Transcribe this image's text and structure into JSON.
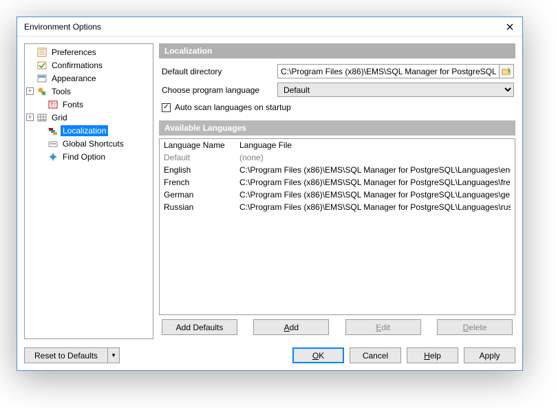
{
  "window_title": "Environment Options",
  "tree": {
    "preferences": "Preferences",
    "confirmations": "Confirmations",
    "appearance": "Appearance",
    "tools": "Tools",
    "fonts": "Fonts",
    "grid": "Grid",
    "localization": "Localization",
    "global_shortcuts": "Global Shortcuts",
    "find_option": "Find Option"
  },
  "section": {
    "localization_head": "Localization",
    "default_dir_label": "Default directory",
    "default_dir_value": "C:\\Program Files (x86)\\EMS\\SQL Manager for PostgreSQL\\Languages",
    "choose_lang_label": "Choose program language",
    "choose_lang_value": "Default",
    "autoscan_label": "Auto scan languages on startup",
    "autoscan_checked": "true",
    "available_head": "Available Languages"
  },
  "cols": {
    "name": "Language Name",
    "file": "Language File"
  },
  "langs": [
    {
      "name": "Default",
      "file": "(none)",
      "dim": true
    },
    {
      "name": "English",
      "file": "C:\\Program Files (x86)\\EMS\\SQL Manager for PostgreSQL\\Languages\\english.lng"
    },
    {
      "name": "French",
      "file": "C:\\Program Files (x86)\\EMS\\SQL Manager for PostgreSQL\\Languages\\french.lng"
    },
    {
      "name": "German",
      "file": "C:\\Program Files (x86)\\EMS\\SQL Manager for PostgreSQL\\Languages\\german.lng"
    },
    {
      "name": "Russian",
      "file": "C:\\Program Files (x86)\\EMS\\SQL Manager for PostgreSQL\\Languages\\russian.lng"
    }
  ],
  "btns": {
    "add_defaults": "Add Defaults",
    "reset": "Reset to Defaults"
  }
}
